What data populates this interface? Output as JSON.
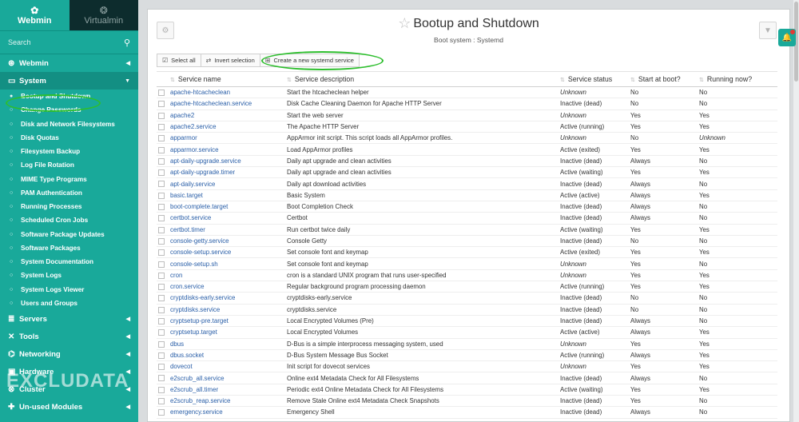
{
  "brand": {
    "active": "Webmin",
    "inactive": "Virtualmin"
  },
  "search": {
    "placeholder": "Search"
  },
  "menu": {
    "sections_top": [
      {
        "label": "Webmin",
        "icon": "gauge-icon"
      },
      {
        "label": "System",
        "icon": "monitor-icon"
      }
    ],
    "system_items": [
      "Bootup and Shutdown",
      "Change Passwords",
      "Disk and Network Filesystems",
      "Disk Quotas",
      "Filesystem Backup",
      "Log File Rotation",
      "MIME Type Programs",
      "PAM Authentication",
      "Running Processes",
      "Scheduled Cron Jobs",
      "Software Package Updates",
      "Software Packages",
      "System Documentation",
      "System Logs",
      "System Logs Viewer",
      "Users and Groups"
    ],
    "sections_bottom": [
      {
        "label": "Servers",
        "icon": "server-icon"
      },
      {
        "label": "Tools",
        "icon": "wrench-icon"
      },
      {
        "label": "Networking",
        "icon": "network-icon"
      },
      {
        "label": "Hardware",
        "icon": "hardware-icon"
      },
      {
        "label": "Cluster",
        "icon": "cluster-icon"
      },
      {
        "label": "Un-used Modules",
        "icon": "puzzle-icon"
      }
    ]
  },
  "watermark": "EXCLUDATA",
  "page": {
    "title": "Bootup and Shutdown",
    "subtitle": "Boot system : Systemd"
  },
  "toolbar": {
    "select_all": "Select all",
    "invert_selection": "Invert selection",
    "create": "Create a new systemd service"
  },
  "table": {
    "columns": [
      "Service name",
      "Service description",
      "Service status",
      "Start at boot?",
      "Running now?"
    ],
    "rows": [
      [
        "apache-htcacheclean",
        "Start the htcacheclean helper",
        "Unknown",
        "No",
        "No"
      ],
      [
        "apache-htcacheclean.service",
        "Disk Cache Cleaning Daemon for Apache HTTP Server",
        "Inactive (dead)",
        "No",
        "No"
      ],
      [
        "apache2",
        "Start the web server",
        "Unknown",
        "Yes",
        "Yes"
      ],
      [
        "apache2.service",
        "The Apache HTTP Server",
        "Active (running)",
        "Yes",
        "Yes"
      ],
      [
        "apparmor",
        "AppArmor init script. This script loads all AppArmor profiles.",
        "Unknown",
        "No",
        "Unknown"
      ],
      [
        "apparmor.service",
        "Load AppArmor profiles",
        "Active (exited)",
        "Yes",
        "Yes"
      ],
      [
        "apt-daily-upgrade.service",
        "Daily apt upgrade and clean activities",
        "Inactive (dead)",
        "Always",
        "No"
      ],
      [
        "apt-daily-upgrade.timer",
        "Daily apt upgrade and clean activities",
        "Active (waiting)",
        "Yes",
        "Yes"
      ],
      [
        "apt-daily.service",
        "Daily apt download activities",
        "Inactive (dead)",
        "Always",
        "No"
      ],
      [
        "basic.target",
        "Basic System",
        "Active (active)",
        "Always",
        "Yes"
      ],
      [
        "boot-complete.target",
        "Boot Completion Check",
        "Inactive (dead)",
        "Always",
        "No"
      ],
      [
        "certbot.service",
        "Certbot",
        "Inactive (dead)",
        "Always",
        "No"
      ],
      [
        "certbot.timer",
        "Run certbot twice daily",
        "Active (waiting)",
        "Yes",
        "Yes"
      ],
      [
        "console-getty.service",
        "Console Getty",
        "Inactive (dead)",
        "No",
        "No"
      ],
      [
        "console-setup.service",
        "Set console font and keymap",
        "Active (exited)",
        "Yes",
        "Yes"
      ],
      [
        "console-setup.sh",
        "Set console font and keymap",
        "Unknown",
        "Yes",
        "No"
      ],
      [
        "cron",
        "cron is a standard UNIX program that runs user-specified",
        "Unknown",
        "Yes",
        "Yes"
      ],
      [
        "cron.service",
        "Regular background program processing daemon",
        "Active (running)",
        "Yes",
        "Yes"
      ],
      [
        "cryptdisks-early.service",
        "cryptdisks-early.service",
        "Inactive (dead)",
        "No",
        "No"
      ],
      [
        "cryptdisks.service",
        "cryptdisks.service",
        "Inactive (dead)",
        "No",
        "No"
      ],
      [
        "cryptsetup-pre.target",
        "Local Encrypted Volumes (Pre)",
        "Inactive (dead)",
        "Always",
        "No"
      ],
      [
        "cryptsetup.target",
        "Local Encrypted Volumes",
        "Active (active)",
        "Always",
        "Yes"
      ],
      [
        "dbus",
        "D-Bus is a simple interprocess messaging system, used",
        "Unknown",
        "Yes",
        "Yes"
      ],
      [
        "dbus.socket",
        "D-Bus System Message Bus Socket",
        "Active (running)",
        "Always",
        "Yes"
      ],
      [
        "dovecot",
        "Init script for dovecot services",
        "Unknown",
        "Yes",
        "Yes"
      ],
      [
        "e2scrub_all.service",
        "Online ext4 Metadata Check for All Filesystems",
        "Inactive (dead)",
        "Always",
        "No"
      ],
      [
        "e2scrub_all.timer",
        "Periodic ext4 Online Metadata Check for All Filesystems",
        "Active (waiting)",
        "Yes",
        "Yes"
      ],
      [
        "e2scrub_reap.service",
        "Remove Stale Online ext4 Metadata Check Snapshots",
        "Inactive (dead)",
        "Yes",
        "No"
      ],
      [
        "emergency.service",
        "Emergency Shell",
        "Inactive (dead)",
        "Always",
        "No"
      ]
    ]
  }
}
